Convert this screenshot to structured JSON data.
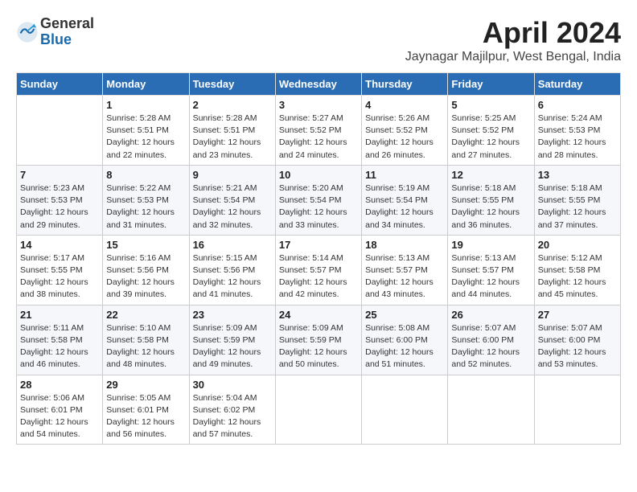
{
  "header": {
    "logo_general": "General",
    "logo_blue": "Blue",
    "month_title": "April 2024",
    "location": "Jaynagar Majilpur, West Bengal, India"
  },
  "weekdays": [
    "Sunday",
    "Monday",
    "Tuesday",
    "Wednesday",
    "Thursday",
    "Friday",
    "Saturday"
  ],
  "weeks": [
    [
      {
        "num": "",
        "sunrise": "",
        "sunset": "",
        "daylight": ""
      },
      {
        "num": "1",
        "sunrise": "Sunrise: 5:28 AM",
        "sunset": "Sunset: 5:51 PM",
        "daylight": "Daylight: 12 hours and 22 minutes."
      },
      {
        "num": "2",
        "sunrise": "Sunrise: 5:28 AM",
        "sunset": "Sunset: 5:51 PM",
        "daylight": "Daylight: 12 hours and 23 minutes."
      },
      {
        "num": "3",
        "sunrise": "Sunrise: 5:27 AM",
        "sunset": "Sunset: 5:52 PM",
        "daylight": "Daylight: 12 hours and 24 minutes."
      },
      {
        "num": "4",
        "sunrise": "Sunrise: 5:26 AM",
        "sunset": "Sunset: 5:52 PM",
        "daylight": "Daylight: 12 hours and 26 minutes."
      },
      {
        "num": "5",
        "sunrise": "Sunrise: 5:25 AM",
        "sunset": "Sunset: 5:52 PM",
        "daylight": "Daylight: 12 hours and 27 minutes."
      },
      {
        "num": "6",
        "sunrise": "Sunrise: 5:24 AM",
        "sunset": "Sunset: 5:53 PM",
        "daylight": "Daylight: 12 hours and 28 minutes."
      }
    ],
    [
      {
        "num": "7",
        "sunrise": "Sunrise: 5:23 AM",
        "sunset": "Sunset: 5:53 PM",
        "daylight": "Daylight: 12 hours and 29 minutes."
      },
      {
        "num": "8",
        "sunrise": "Sunrise: 5:22 AM",
        "sunset": "Sunset: 5:53 PM",
        "daylight": "Daylight: 12 hours and 31 minutes."
      },
      {
        "num": "9",
        "sunrise": "Sunrise: 5:21 AM",
        "sunset": "Sunset: 5:54 PM",
        "daylight": "Daylight: 12 hours and 32 minutes."
      },
      {
        "num": "10",
        "sunrise": "Sunrise: 5:20 AM",
        "sunset": "Sunset: 5:54 PM",
        "daylight": "Daylight: 12 hours and 33 minutes."
      },
      {
        "num": "11",
        "sunrise": "Sunrise: 5:19 AM",
        "sunset": "Sunset: 5:54 PM",
        "daylight": "Daylight: 12 hours and 34 minutes."
      },
      {
        "num": "12",
        "sunrise": "Sunrise: 5:18 AM",
        "sunset": "Sunset: 5:55 PM",
        "daylight": "Daylight: 12 hours and 36 minutes."
      },
      {
        "num": "13",
        "sunrise": "Sunrise: 5:18 AM",
        "sunset": "Sunset: 5:55 PM",
        "daylight": "Daylight: 12 hours and 37 minutes."
      }
    ],
    [
      {
        "num": "14",
        "sunrise": "Sunrise: 5:17 AM",
        "sunset": "Sunset: 5:55 PM",
        "daylight": "Daylight: 12 hours and 38 minutes."
      },
      {
        "num": "15",
        "sunrise": "Sunrise: 5:16 AM",
        "sunset": "Sunset: 5:56 PM",
        "daylight": "Daylight: 12 hours and 39 minutes."
      },
      {
        "num": "16",
        "sunrise": "Sunrise: 5:15 AM",
        "sunset": "Sunset: 5:56 PM",
        "daylight": "Daylight: 12 hours and 41 minutes."
      },
      {
        "num": "17",
        "sunrise": "Sunrise: 5:14 AM",
        "sunset": "Sunset: 5:57 PM",
        "daylight": "Daylight: 12 hours and 42 minutes."
      },
      {
        "num": "18",
        "sunrise": "Sunrise: 5:13 AM",
        "sunset": "Sunset: 5:57 PM",
        "daylight": "Daylight: 12 hours and 43 minutes."
      },
      {
        "num": "19",
        "sunrise": "Sunrise: 5:13 AM",
        "sunset": "Sunset: 5:57 PM",
        "daylight": "Daylight: 12 hours and 44 minutes."
      },
      {
        "num": "20",
        "sunrise": "Sunrise: 5:12 AM",
        "sunset": "Sunset: 5:58 PM",
        "daylight": "Daylight: 12 hours and 45 minutes."
      }
    ],
    [
      {
        "num": "21",
        "sunrise": "Sunrise: 5:11 AM",
        "sunset": "Sunset: 5:58 PM",
        "daylight": "Daylight: 12 hours and 46 minutes."
      },
      {
        "num": "22",
        "sunrise": "Sunrise: 5:10 AM",
        "sunset": "Sunset: 5:58 PM",
        "daylight": "Daylight: 12 hours and 48 minutes."
      },
      {
        "num": "23",
        "sunrise": "Sunrise: 5:09 AM",
        "sunset": "Sunset: 5:59 PM",
        "daylight": "Daylight: 12 hours and 49 minutes."
      },
      {
        "num": "24",
        "sunrise": "Sunrise: 5:09 AM",
        "sunset": "Sunset: 5:59 PM",
        "daylight": "Daylight: 12 hours and 50 minutes."
      },
      {
        "num": "25",
        "sunrise": "Sunrise: 5:08 AM",
        "sunset": "Sunset: 6:00 PM",
        "daylight": "Daylight: 12 hours and 51 minutes."
      },
      {
        "num": "26",
        "sunrise": "Sunrise: 5:07 AM",
        "sunset": "Sunset: 6:00 PM",
        "daylight": "Daylight: 12 hours and 52 minutes."
      },
      {
        "num": "27",
        "sunrise": "Sunrise: 5:07 AM",
        "sunset": "Sunset: 6:00 PM",
        "daylight": "Daylight: 12 hours and 53 minutes."
      }
    ],
    [
      {
        "num": "28",
        "sunrise": "Sunrise: 5:06 AM",
        "sunset": "Sunset: 6:01 PM",
        "daylight": "Daylight: 12 hours and 54 minutes."
      },
      {
        "num": "29",
        "sunrise": "Sunrise: 5:05 AM",
        "sunset": "Sunset: 6:01 PM",
        "daylight": "Daylight: 12 hours and 56 minutes."
      },
      {
        "num": "30",
        "sunrise": "Sunrise: 5:04 AM",
        "sunset": "Sunset: 6:02 PM",
        "daylight": "Daylight: 12 hours and 57 minutes."
      },
      {
        "num": "",
        "sunrise": "",
        "sunset": "",
        "daylight": ""
      },
      {
        "num": "",
        "sunrise": "",
        "sunset": "",
        "daylight": ""
      },
      {
        "num": "",
        "sunrise": "",
        "sunset": "",
        "daylight": ""
      },
      {
        "num": "",
        "sunrise": "",
        "sunset": "",
        "daylight": ""
      }
    ]
  ]
}
